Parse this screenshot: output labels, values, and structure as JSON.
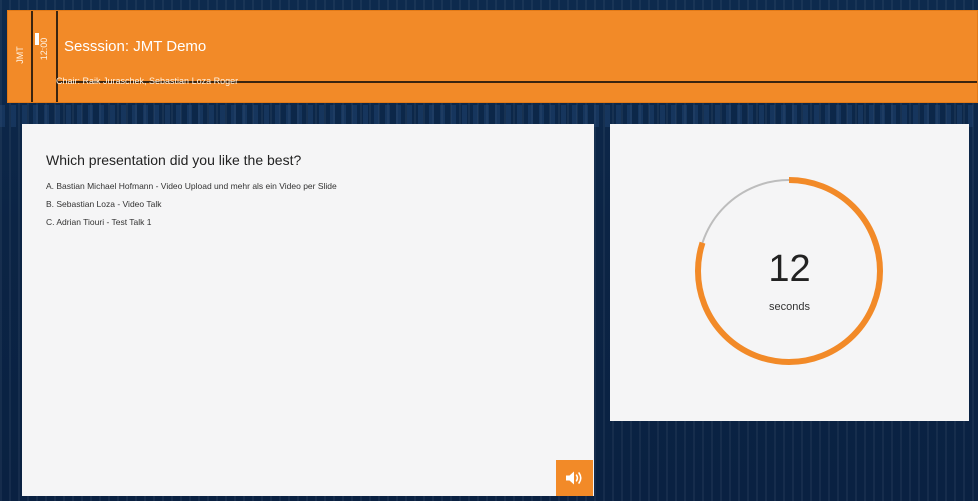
{
  "header": {
    "room_label": "JMT",
    "time_label": "12:00",
    "session_title": "Sesssion: JMT Demo",
    "chair_text": "Chair: Raik Juraschek, Sebastian Loza Roger"
  },
  "poll": {
    "question": "Which presentation did you like the best?",
    "options": [
      "A. Bastian Michael Hofmann - Video Upload und mehr als ein Video per Slide",
      "B. Sebastian Loza - Video Talk",
      "C. Adrian Tiouri - Test Talk 1"
    ]
  },
  "timer": {
    "value": "12",
    "unit": "seconds",
    "remaining_fraction": 0.8
  },
  "controls": {
    "sound_icon": "speaker-icon"
  },
  "colors": {
    "accent": "#f28a28",
    "track": "#bdbdbd",
    "background": "#0c2748",
    "panel": "#f5f5f6"
  }
}
